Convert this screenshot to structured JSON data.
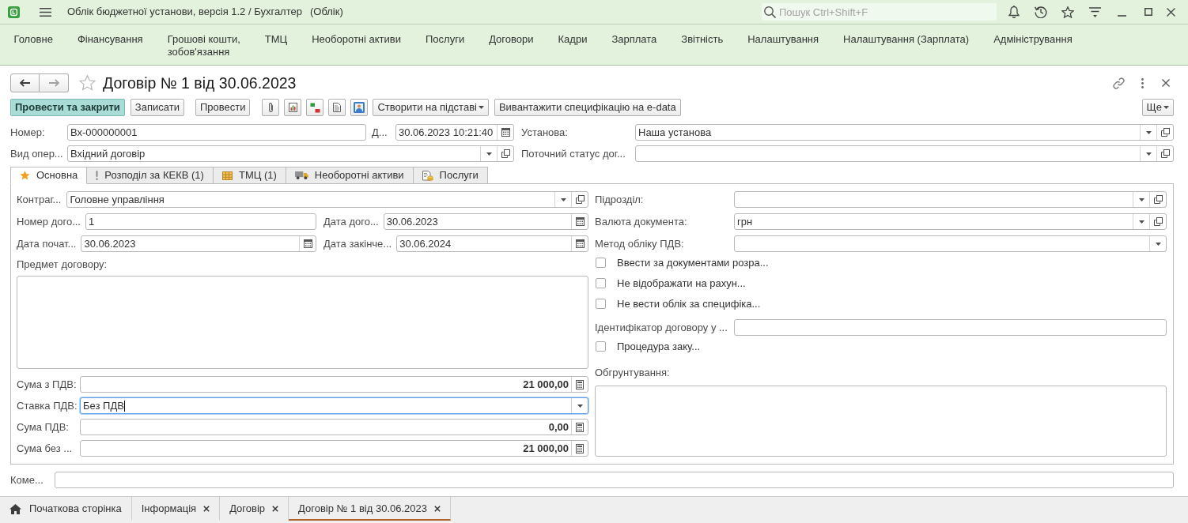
{
  "window": {
    "title": "Облік бюджетної установи, версія 1.2 / Бухгалтер",
    "mode": "(Облік)",
    "search": {
      "placeholder": "Пошук Ctrl+Shift+F"
    }
  },
  "sections": [
    {
      "label": "Головне"
    },
    {
      "label": "Фінансування"
    },
    {
      "label": "Грошові кошти,\nзобов'язання"
    },
    {
      "label": "ТМЦ"
    },
    {
      "label": "Необоротні активи"
    },
    {
      "label": "Послуги"
    },
    {
      "label": "Договори"
    },
    {
      "label": "Кадри"
    },
    {
      "label": "Зарплата"
    },
    {
      "label": "Звітність"
    },
    {
      "label": "Налаштування"
    },
    {
      "label": "Налаштування (Зарплата)"
    },
    {
      "label": "Адміністрування"
    }
  ],
  "form": {
    "title": "Договір № 1 від 30.06.2023",
    "favorite": false,
    "back": {
      "disabled": false
    },
    "forward": {
      "disabled": true
    },
    "command_bar": {
      "buttons_left": [
        {
          "label": "Провести та закрити",
          "default": true
        },
        {
          "label": "Записати",
          "default": false
        },
        {
          "label": "Провести",
          "default": false
        }
      ],
      "buttons_right": [
        {
          "label": "Створити на підставі",
          "dropdown": true
        },
        {
          "label": "Вивантажити специфікацію на e-data",
          "dropdown": false
        }
      ],
      "more": {
        "label": "Ще",
        "dropdown": true
      }
    },
    "header": {
      "number": {
        "kind": "text",
        "label": "Номер:",
        "value": "Вх-000000001"
      },
      "date": {
        "kind": "date",
        "label": "Д...",
        "value": "30.06.2023 10:21:40"
      },
      "institution": {
        "kind": "select",
        "label": "Установа:",
        "value": "Наша установа"
      },
      "operation": {
        "kind": "select",
        "label": "Вид опер...",
        "value": "Вхідний договір"
      },
      "status": {
        "kind": "select",
        "label": "Поточний статус дог..."
      }
    },
    "tabs": [
      {
        "label": "Основна",
        "selected": true
      },
      {
        "label": "Розподіл за КЕКВ (1)",
        "selected": false
      },
      {
        "label": "ТМЦ (1)",
        "selected": false
      },
      {
        "label": "Необоротні активи",
        "selected": false
      },
      {
        "label": "Послуги",
        "selected": false
      }
    ],
    "main_tab": {
      "left_rows": [
        [
          {
            "kind": "select",
            "label": "Контраг...",
            "value": "Головне управління"
          }
        ],
        [
          {
            "kind": "text",
            "label": "Номер дого...",
            "value": "1"
          },
          {
            "kind": "date",
            "label": "Дата дого...",
            "value": "30.06.2023"
          }
        ],
        [
          {
            "kind": "date",
            "label": "Дата почат...",
            "value": "30.06.2023"
          },
          {
            "kind": "date",
            "label": "Дата закінче...",
            "value": "30.06.2024"
          }
        ]
      ],
      "subject": {
        "label": "Предмет договору:"
      },
      "amounts": [
        {
          "kind": "number",
          "label": "Сума з ПДВ:",
          "value": "21 000,00",
          "focused": false
        },
        {
          "kind": "choice",
          "label": "Ставка ПДВ:",
          "value": "Без ПДВ",
          "focused": true
        },
        {
          "kind": "number",
          "label": "Сума ПДВ:",
          "value": "0,00",
          "focused": false
        },
        {
          "kind": "number",
          "label": "Сума без ...",
          "value": "21 000,00",
          "focused": false
        }
      ],
      "right_rows": [
        {
          "kind": "select",
          "label": "Підрозділ:"
        },
        {
          "kind": "select",
          "label": "Валюта документа:",
          "value": "грн"
        },
        {
          "kind": "choice",
          "label": "Метод обліку ПДВ:"
        },
        {
          "kind": "checkbox",
          "label": "Ввести за документами розра...",
          "checked": false
        },
        {
          "kind": "checkbox",
          "label": "Не відображати на рахун...",
          "checked": false
        },
        {
          "kind": "checkbox",
          "label": "Не вести облік за специфіка...",
          "checked": false
        },
        {
          "kind": "text",
          "label": "Ідентифікатор договору у ..."
        },
        {
          "kind": "checkbox",
          "label": "Процедура заку...",
          "checked": false
        },
        {
          "kind": "textarea",
          "label": "Обгрунтування:"
        }
      ]
    },
    "comment": {
      "kind": "text",
      "label": "Коме..."
    }
  },
  "open_windows": [
    {
      "kind": "home",
      "label": "Початкова сторінка",
      "selected": false
    },
    {
      "kind": "document",
      "label": "Інформація",
      "selected": false
    },
    {
      "kind": "document",
      "label": "Договір",
      "selected": false
    },
    {
      "kind": "document",
      "label": "Договір № 1 від 30.06.2023",
      "selected": true
    }
  ]
}
